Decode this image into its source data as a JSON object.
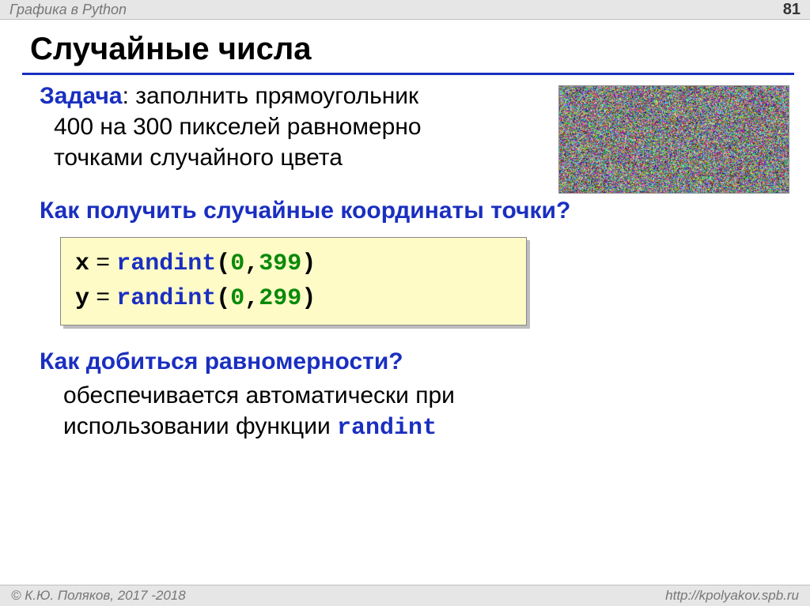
{
  "header": {
    "left": "Графика в Python",
    "page": "81"
  },
  "title": "Случайные числа",
  "task": {
    "label": "Задача",
    "colon": ": ",
    "line1": "заполнить прямоугольник",
    "line2": "400 на 300 пикселей равномерно",
    "line3": "точками случайного цвета"
  },
  "q1": "Как получить случайные координаты точки?",
  "code": {
    "var1": "x",
    "eq": " = ",
    "fn": "randint",
    "open": "(",
    "n0": "0",
    "comma": ",",
    "n399": "399",
    "close": ")",
    "var2": "y",
    "n299": "299"
  },
  "q2": "Как добиться равномерности?",
  "answer": {
    "line1": "обеспечивается автоматически при",
    "line2_a": "использовании  функции ",
    "line2_mono": "randint"
  },
  "footer": {
    "left": " К.Ю. Поляков, 2017 -2018",
    "right": "http://kpolyakov.spb.ru"
  }
}
